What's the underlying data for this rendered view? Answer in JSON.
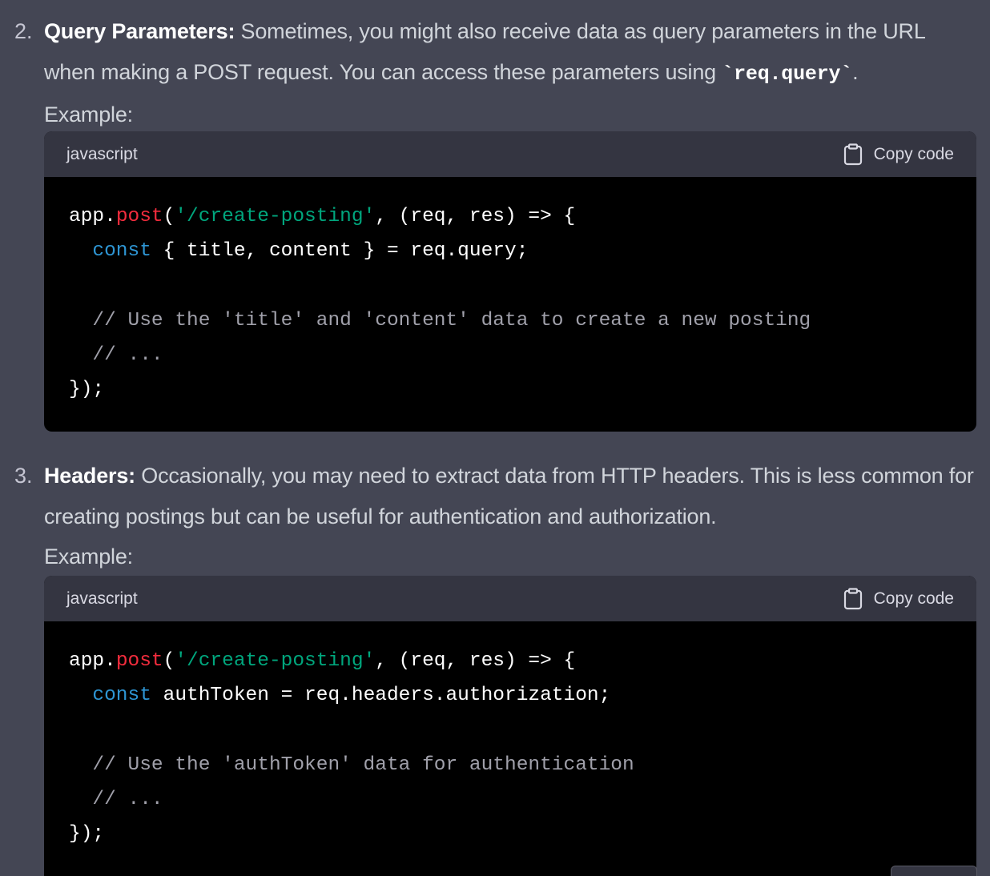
{
  "items": [
    {
      "number": "2.",
      "title": "Query Parameters:",
      "text_before": " Sometimes, you might also receive data as query parameters in the URL when making a POST request. You can access these parameters using ",
      "code_inline": "`req.query`",
      "text_after": ".",
      "example_label": "Example:",
      "code": {
        "language": "javascript",
        "copy_label": "Copy code",
        "lines": [
          [
            {
              "t": "app."
            },
            {
              "t": "post",
              "c": "f"
            },
            {
              "t": "("
            },
            {
              "t": "'/create-posting'",
              "c": "s"
            },
            {
              "t": ", (req, res) => {"
            }
          ],
          [
            {
              "t": "  "
            },
            {
              "t": "const",
              "c": "k"
            },
            {
              "t": " { title, content } = req.query;"
            }
          ],
          [
            {
              "t": ""
            }
          ],
          [
            {
              "t": "  "
            },
            {
              "t": "// Use the 'title' and 'content' data to create a new posting",
              "c": "c"
            }
          ],
          [
            {
              "t": "  "
            },
            {
              "t": "// ...",
              "c": "c"
            }
          ],
          [
            {
              "t": "});"
            }
          ]
        ]
      }
    },
    {
      "number": "3.",
      "title": "Headers:",
      "text_before": " Occasionally, you may need to extract data from HTTP headers. This is less common for creating postings but can be useful for authentication and authorization.",
      "code_inline": "",
      "text_after": "",
      "example_label": "Example:",
      "code": {
        "language": "javascript",
        "copy_label": "Copy code",
        "lines": [
          [
            {
              "t": "app."
            },
            {
              "t": "post",
              "c": "f"
            },
            {
              "t": "("
            },
            {
              "t": "'/create-posting'",
              "c": "s"
            },
            {
              "t": ", (req, res) => {"
            }
          ],
          [
            {
              "t": "  "
            },
            {
              "t": "const",
              "c": "k"
            },
            {
              "t": " authToken = req.headers.authorization;"
            }
          ],
          [
            {
              "t": ""
            }
          ],
          [
            {
              "t": "  "
            },
            {
              "t": "// Use the 'authToken' data for authentication",
              "c": "c"
            }
          ],
          [
            {
              "t": "  "
            },
            {
              "t": "// ...",
              "c": "c"
            }
          ],
          [
            {
              "t": "});"
            }
          ]
        ]
      }
    }
  ]
}
